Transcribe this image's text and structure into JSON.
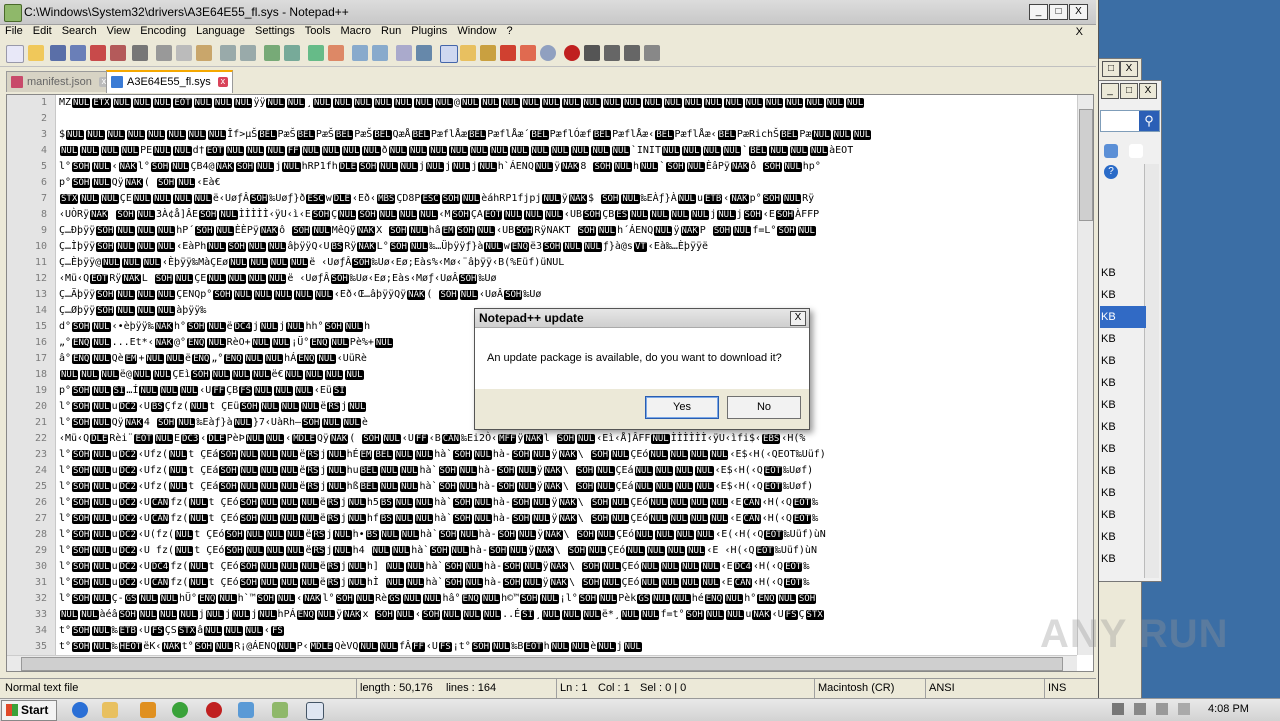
{
  "window": {
    "title": "C:\\Windows\\System32\\drivers\\A3E64E55_fl.sys - Notepad++",
    "minimize": "_",
    "maximize": "□",
    "close": "X"
  },
  "menu": [
    "File",
    "Edit",
    "Search",
    "View",
    "Encoding",
    "Language",
    "Settings",
    "Tools",
    "Macro",
    "Run",
    "Plugins",
    "Window",
    "?"
  ],
  "menu_close": "X",
  "tabs": [
    {
      "label": "manifest.json",
      "active": false
    },
    {
      "label": "A3E64E55_fl.sys",
      "active": true
    }
  ],
  "editor": {
    "lines": [
      {
        "n": "1",
        "t": "MZ[NUL][ETX][NUL][NUL][NUL][EOT][NUL][NUL][NUL]ÿÿ[NUL][NUL]¸[NUL][NUL][NUL][NUL][NUL][NUL][NUL]@[NUL][NUL][NUL][NUL][NUL][NUL][NUL][NUL][NUL][NUL][NUL][NUL][NUL][NUL][NUL][NUL][NUL][NUL][NUL][NUL]"
      },
      {
        "n": "2",
        "t": ""
      },
      {
        "n": "3",
        "t": "$[NUL][NUL][NUL][NUL][NUL][NUL][NUL][NUL]Îf>µŠ[BEL]PæŠ[BEL]PæŠ[BEL]PæŠ[BEL]QæÅ[BEL]PæflÅæ[BEL]PæflÅæ´[BEL]PæflÓæf[BEL]PæflÅæ‹[BEL]PæflÅæ‹[BEL]PæRichŠ[BEL]Pæ[NUL][NUL][NUL]"
      },
      {
        "n": "4",
        "t": "[NUL][NUL][NUL][NUL]PE[NUL][NUL]d†[EOT][NUL][NUL][NUL][FF][NUL][NUL][NUL][NUL]ð[NUL][NUL][NUL][NUL][NUL][NUL][NUL][NUL][NUL][NUL][NUL][NUL]`INIT[NUL][NUL][NUL][NUL]`[BEL][NUL][NUL][NUL]àEOT"
      },
      {
        "n": "5",
        "t": "l°[SOH][NUL]‹[NAK]l°[SOH][NUL]ÇB4@[NAK][SOH][NUL]j[NUL]hRP1fh[DLE][SOH][NUL][NUL]j[NUL]j[NUL]j[NUL]h`ÁENQ[NUL]ÿ[NAK]8 [SOH][NUL]h[NUL]`[SOH][NUL]ÈâPÿ[NAK]ô [SOH][NUL]hp°"
      },
      {
        "n": "6",
        "t": "p°[SOH][NUL]Qÿ[NAK]( [SOH][NUL]‹Eà€"
      },
      {
        "n": "7",
        "t": "[STX][NUL][NUL]ÇE[NUL][NUL][NUL][NUL]ë‹UøƒÂ[SOH]‰Uøƒ}ð[ESC]w[DLE]‹Eð‹[MBS]ÇD8P[ESC][SOH][NUL]èáhRP1fjpj[NUL]ÿ[NAK]$ [SOH][NUL]‰EÀƒ}À[NUL]u[ETB]‹[NAK]p°[SOH][NUL]Rÿ"
      },
      {
        "n": "8",
        "t": "‹UÒRÿ[NAK] [SOH][NUL]3À¢å]ÂE[SOH][NUL]ÌÌÌÌÌ‹ÿU‹ì‹E[SOH]Ç[NUL][SOH][NUL][NUL][NUL]‹M[SOH]ÇA[EOT][NUL][NUL][NUL]‹UB[SOH]ÇB[ES][NUL][NUL][NUL][NUL]j[NUL]j[SOH]‹E[SOH]ÀFFP"
      },
      {
        "n": "9",
        "t": "Ç…Ðþÿÿ[SOH][NUL][NUL][NUL]hP´[SOH][NUL]ÈÈPÿ[NAK]ô [SOH][NUL]MêQÿ[NAK]X [SOH][NUL]hâ[EM][SOH][NUL]‹UB[SOH]RÿNAKT [SOH][NUL]h´ÁENQ[NUL]ÿ[NAK]P [SOH][NUL]f=L°[SOH][NUL]"
      },
      {
        "n": "10",
        "t": "Ç…Ìþÿÿ[SOH][NUL][NUL][NUL]‹EàPh[NUL][SOH][NUL][NUL]âþÿÿQ‹U[BS]Rÿ[NAK]L°[SOH][NUL]‰…Üþÿÿƒ}à[NUL]w[ENQ]ë3[SOH][NUL][NUL]ƒ}à@s[VT]‹Eà‰…Èþÿÿë"
      },
      {
        "n": "11",
        "t": "Ç…Èþÿÿ@[NUL][NUL][NUL]‹Èþÿÿ‰MàÇEø[NUL][NUL][NUL][NUL]ë ‹UøƒÂ[SOH]‰Uø‹Eø;Eàs%‹Mø‹¨âþÿÿ‹B(%Eüf)üNUL"
      },
      {
        "n": "12",
        "t": "‹Mü‹Q[EOT]Rÿ[NAK]L [SOH][NUL]ÇE[NUL][NUL][NUL][NUL]ë ‹UøƒÂ[SOH]‰Uø‹Eø;Eàs‹Møƒ‹UøÂ[SOH]‰Uø"
      },
      {
        "n": "13",
        "t": "Ç…Äþÿÿ[SOH][NUL][NUL][NUL]ÇENQp°[SOH][NUL][NUL][NUL][NUL][NUL]‹Eð‹Œ…âþÿÿQÿ[NAK]( [SOH][NUL]‹UøÂ[SOH]‰Uø"
      },
      {
        "n": "14",
        "t": "Ç…Øþÿÿ[SOH][NUL][NUL][NUL]àþÿÿ‰"
      },
      {
        "n": "15",
        "t": "d°[SOH][NUL]‹•èþÿÿ‰[NAK]h°[SOH][NUL]ë[DC4]j[NUL]j[NUL]hh°[SOH][NUL]h"
      },
      {
        "n": "16",
        "t": "„°[ENQ][NUL]...Et*‹[NAK]@°[ENQ][NUL]RèO+[NUL][NUL]¡Ü°[ENQ][NUL]Pè%+[NUL]"
      },
      {
        "n": "17",
        "t": "â°[ENQ][NUL]Qè[EM]+[NUL][NUL]ë[ENQ]„°[ENQ][NUL][NUL]hÁ[ENQ][NUL]‹UüRè"
      },
      {
        "n": "18",
        "t": "[NUL][NUL][NUL]ë@[NUL][NUL]ÇEì[SOH][NUL][NUL][NUL]ë€[NUL][NUL][NUL][NUL]"
      },
      {
        "n": "19",
        "t": "p°[SOH][NUL][SI]…Í[NUL][NUL][NUL]‹U[FF]ÇB[FS][NUL][NUL][NUL]‹Eü[SI]"
      },
      {
        "n": "20",
        "t": "l°[SOH][NUL]u[DC2]‹U[BS]Çfz([NUL]t  ÇEü[SOH][NUL][NUL][NUL]ë[RS]j[NUL]"
      },
      {
        "n": "21",
        "t": "l°[SOH][NUL]Qÿ[NAK]4 [SOH][NUL]‰Eàƒ}à[NUL]}7‹UàRh—[SOH][NUL][NUL]è"
      },
      {
        "n": "22",
        "t": "‹Mü‹Q[DLE]Rèi¨[EOT][NUL]E[DC3]‹[DLE]PèÞ[NUL][NUL]‹[MDLE]Qÿ[NAK]( [SOH][NUL]‹U[FF]‹B[CAN]‰Ei2Ò‹[MFF]ÿ[NAK]l [SOH][NUL]‹Eì‹Å]ÂFF[NUL]ÌÌÌÌÌÌ‹ÿU‹ìfi$‹[EBS]‹H(%"
      },
      {
        "n": "23",
        "t": "l°[SOH][NUL]u[DC2]‹Ufz([NUL]t ÇEá[SOH][NUL][NUL][NUL]ë[RS]j[NUL]hÉ[EM][BEL][NUL][NUL]hà`[SOH][NUL]hà-[SOH][NUL]ÿ[NAK]\\ [SOH][NUL]ÇEó[NUL][NUL][NUL][NUL]‹E$‹H(‹QEOT‰Uüf)"
      },
      {
        "n": "24",
        "t": "l°[SOH][NUL]u[DC2]‹Ufz([NUL]t ÇEá[SOH][NUL][NUL][NUL]ë[RS]j[NUL]hu[BEL][NUL][NUL]hà`[SOH][NUL]hà-[SOH][NUL]ÿ[NAK]\\ [SOH][NUL]ÇEá[NUL][NUL][NUL][NUL]‹E$‹H(‹Q[EOT]‰Uøf)"
      },
      {
        "n": "25",
        "t": "l°[SOH][NUL]u[DC2]‹Ufz([NUL]t ÇEá[SOH][NUL][NUL][NUL]ë[RS]j[NUL]hß[BEL][NUL][NUL]hà`[SOH][NUL]hà-[SOH][NUL]ÿ[NAK]\\ [SOH][NUL]ÇEá[NUL][NUL][NUL][NUL]‹E$‹H(‹Q[EOT]‰Uøf)"
      },
      {
        "n": "26",
        "t": "l°[SOH][NUL]u[DC2]‹U[CAN]fz([NUL]t  ÇEó[SOH][NUL][NUL][NUL]ë[RS]j[NUL]h5[BS][NUL][NUL]hà`[SOH][NUL]hà-[SOH][NUL]ÿ[NAK]\\ [SOH][NUL]ÇEó[NUL][NUL][NUL][NUL]‹E[CAN]‹H(‹Q[EOT]‰"
      },
      {
        "n": "27",
        "t": "l°[SOH][NUL]u[DC2]‹U[CAN]fz([NUL]t  ÇEó[SOH][NUL][NUL][NUL]ë[RS]j[NUL]hf[BS][NUL][NUL]hà`[SOH][NUL]hà-[SOH][NUL]ÿ[NAK]\\ [SOH][NUL]ÇEó[NUL][NUL][NUL][NUL]‹E[CAN]‹H(‹Q[EOT]‰"
      },
      {
        "n": "28",
        "t": "l°[SOH][NUL]u[DC2]‹U(fz([NUL]t ÇEó[SOH][NUL][NUL][NUL]ë[RS]j[NUL]h•[BS][NUL][NUL]hà`[SOH][NUL]hà-[SOH][NUL]ÿ[NAK]\\ [SOH][NUL]ÇEó[NUL][NUL][NUL][NUL]‹E(‹H(‹Q[EOT]‰Uüf)ùN"
      },
      {
        "n": "29",
        "t": "l°[SOH][NUL]u[DC2]‹U fz([NUL]t ÇEó[SOH][NUL][NUL][NUL]ë[RS]j[NUL]h4 [NUL][NUL]hà`[SOH][NUL]hà-[SOH][NUL]ÿ[NAK]\\ [SOH][NUL]ÇEó[NUL][NUL][NUL][NUL]‹E ‹H(‹Q[EOT]‰Uüf)ùN"
      },
      {
        "n": "30",
        "t": "l°[SOH][NUL]u[DC2]‹U[DC4]fz([NUL]t  ÇEó[SOH][NUL][NUL][NUL]ë[RS]j[NUL]h] [NUL][NUL]hà`[SOH][NUL]hà-[SOH][NUL]ÿ[NAK]\\ [SOH][NUL]ÇEó[NUL][NUL][NUL][NUL]‹E[DC4]‹H(‹Q[EOT]‰"
      },
      {
        "n": "31",
        "t": "l°[SOH][NUL]u[DC2]‹U[CAN]fz([NUL]t  ÇEó[SOH][NUL][NUL][NUL]ë[RS]j[NUL]hÌ  [NUL][NUL]hà`[SOH][NUL]hà-[SOH][NUL]ÿ[NAK]\\ [SOH][NUL]ÇEó[NUL][NUL][NUL][NUL]‹E[CAN]‹H(‹Q[EOT]‰"
      },
      {
        "n": "32",
        "t": "l°[SOH][NUL]Ç-[GS][NUL][NUL]hÜ°[ENQ][NUL]h`™[SOH][NUL]‹[NAK]l°[SOH][NUL]Rè[GS][NUL][NUL]hâ°[ENQ][NUL]h©™[SOH][NUL]¡l°[SOH][NUL]Pèk[GS][NUL][NUL]hé[ENQ][NUL]h°[ENQ][NUL][SOH]"
      },
      {
        "n": "33",
        "t": "[NUL][NUL]àéâ[SOH][NUL][NUL][NUL]j[NUL]j[NUL]j[NUL]hPÁ[ENQ][NUL]ÿ[NAK]x [SOH][NUL]‹[SOH][NUL][NUL][NUL]..É[SI]¸[NUL][NUL][NUL]ë*¸[NUL][NUL]f=t°[SOH][NUL][NUL]u[NAK]‹U[FS]Ç[STX]"
      },
      {
        "n": "34",
        "t": "t°[SOH][NUL]‰[ETB]‹U[FS]ÇS[STX]â[NUL][NUL][NUL]‹[FS]"
      },
      {
        "n": "35",
        "t": "t°[SOH][NUL]‰[HEOT]ëK‹[NAK]t°[SOH][NUL]R¡@ÁENQ[NUL]P‹[MDLE]QèVQ[NUL][NUL]fÂ[FF]‹U[FS]¡t°[SOH][NUL]‰B[EOT]h[NUL][NUL]è[NUL]j[NUL]"
      }
    ]
  },
  "status": {
    "type": "Normal text file",
    "length": "length : 50,176",
    "lines": "lines : 164",
    "ln": "Ln : 1",
    "col": "Col : 1",
    "sel": "Sel : 0 | 0",
    "eol": "Macintosh (CR)",
    "encoding": "ANSI",
    "mode": "INS"
  },
  "dialog": {
    "title": "Notepad++ update",
    "close": "X",
    "message": "An update package is available, do you want to download it?",
    "yes": "Yes",
    "no": "No"
  },
  "background_window": {
    "kb_items": [
      "KB",
      "KB",
      "KB",
      "KB",
      "KB",
      "KB",
      "KB",
      "KB",
      "KB",
      "KB",
      "KB",
      "KB",
      "KB",
      "KB"
    ],
    "selected_index": 2,
    "min": "_",
    "max": "□",
    "close": "X",
    "search_icon": "search-icon",
    "help": "?"
  },
  "taskbar": {
    "start": "Start",
    "clock": "4:08 PM"
  },
  "watermark": "ANY RUN",
  "colors": {
    "accent": "#316ac5",
    "tab_active_border": "#f5a800",
    "control_char_bg": "#000000",
    "desktop": "#3b6ea5"
  }
}
